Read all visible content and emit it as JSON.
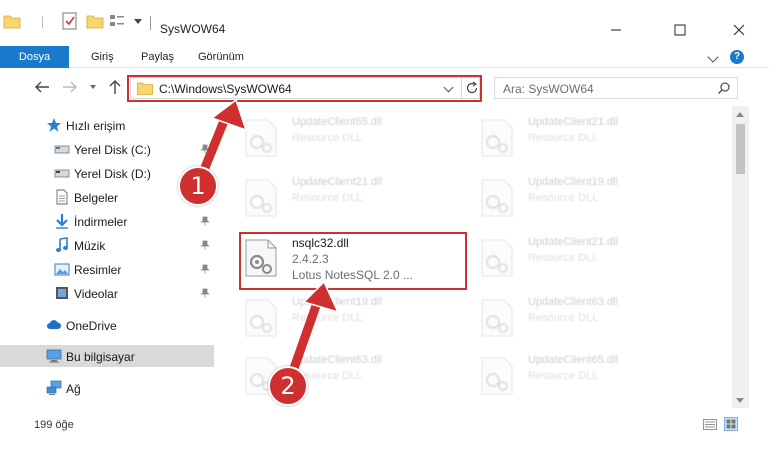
{
  "window": {
    "title": "SysWOW64"
  },
  "ribbon": {
    "tabs": [
      "Dosya",
      "Giriş",
      "Paylaş",
      "Görünüm"
    ],
    "help_glyph": "?"
  },
  "navigation": {
    "address": "C:\\Windows\\SysWOW64",
    "search_placeholder": "Ara: SysWOW64"
  },
  "sidebar": {
    "items": [
      {
        "label": "Hızlı erişim",
        "icon": "star-icon"
      },
      {
        "label": "Yerel Disk (C:)",
        "icon": "drive-icon"
      },
      {
        "label": "Yerel Disk (D:)",
        "icon": "drive-icon"
      },
      {
        "label": "Belgeler",
        "icon": "documents-icon"
      },
      {
        "label": "İndirmeler",
        "icon": "downloads-icon"
      },
      {
        "label": "Müzik",
        "icon": "music-icon"
      },
      {
        "label": "Resimler",
        "icon": "pictures-icon"
      },
      {
        "label": "Videolar",
        "icon": "videos-icon"
      },
      {
        "label": "OneDrive",
        "icon": "cloud-icon"
      },
      {
        "label": "Bu bilgisayar",
        "icon": "computer-icon"
      },
      {
        "label": "Ağ",
        "icon": "network-icon"
      }
    ]
  },
  "files": {
    "left": [
      {
        "name": "UpdateClient65.dll",
        "desc": "Resource DLL"
      },
      {
        "name": "UpdateClient21.dll",
        "desc": "Resource DLL"
      },
      {
        "name": "nsqlc32.dll",
        "desc": "2.4.2.3",
        "extra": "Lotus NotesSQL 2.0 ..."
      },
      {
        "name": "UpdateClient19.dll",
        "desc": "Resource DLL"
      },
      {
        "name": "UpdateClient63.dll",
        "desc": "Resource DLL"
      }
    ],
    "right": [
      {
        "name": "UpdateClient21.dll",
        "desc": "Resource DLL"
      },
      {
        "name": "UpdateClient19.dll",
        "desc": "Resource DLL"
      },
      {
        "name": "UpdateClient21.dll",
        "desc": "Resource DLL"
      },
      {
        "name": "UpdateClient63.dll",
        "desc": "Resource DLL"
      },
      {
        "name": "UpdateClient65.dll",
        "desc": "Resource DLL"
      }
    ]
  },
  "status": {
    "item_count": "199 öğe"
  },
  "annotations": {
    "step1": "1",
    "step2": "2",
    "highlight_color": "#cf2f2f"
  },
  "colors": {
    "accent": "#1979ca",
    "selection": "#d9d9d9"
  }
}
